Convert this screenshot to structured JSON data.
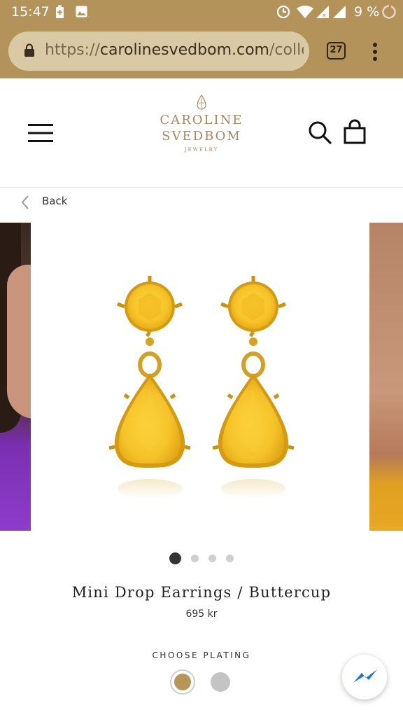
{
  "status_bar": {
    "time": "15:47",
    "battery_percent": "9 %",
    "icons": [
      "battery-saver-icon",
      "image-icon",
      "data-saver-icon",
      "wifi-icon",
      "signal-icon",
      "signal-icon",
      "battery-ring-icon"
    ]
  },
  "browser": {
    "url_scheme": "https://",
    "url_host": "carolinesvedbom.com",
    "url_path": "/colle",
    "tab_count": "27",
    "toolbar_color": "#b3935a"
  },
  "header": {
    "logo_line1": "CAROLINE",
    "logo_line2": "SVEDBOM",
    "logo_line3": "JEWELRY",
    "brand_color": "#a88a5c"
  },
  "nav": {
    "back_label": "Back"
  },
  "product": {
    "title": "Mini Drop Earrings / Buttercup",
    "price": "695 kr",
    "image_count": 4,
    "active_image": 1,
    "stone_color": "#f5c52a"
  },
  "plating": {
    "label": "CHOOSE PLATING",
    "options": [
      {
        "name": "gold",
        "color": "#b8965a",
        "selected": true
      },
      {
        "name": "silver",
        "color": "#c4c4c4",
        "selected": false
      }
    ]
  }
}
